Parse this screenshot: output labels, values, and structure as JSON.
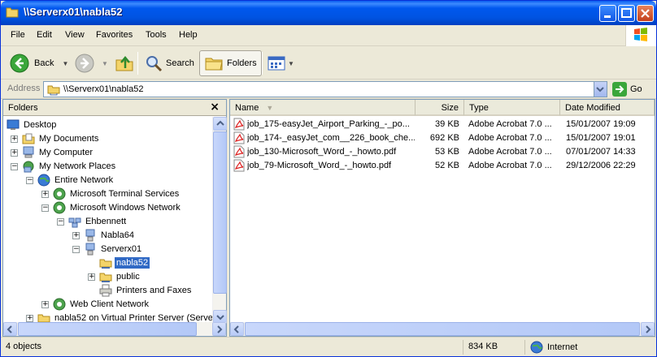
{
  "window": {
    "title": "\\\\Serverx01\\nabla52"
  },
  "menu": [
    "File",
    "Edit",
    "View",
    "Favorites",
    "Tools",
    "Help"
  ],
  "toolbar": {
    "back_label": "Back",
    "search_label": "Search",
    "folders_label": "Folders"
  },
  "address": {
    "label": "Address",
    "value": "\\\\Serverx01\\nabla52",
    "go_label": "Go"
  },
  "folders_pane": {
    "title": "Folders",
    "close_glyph": "×",
    "tree": [
      {
        "label": "Desktop"
      },
      {
        "label": "My Documents"
      },
      {
        "label": "My Computer"
      },
      {
        "label": "My Network Places"
      },
      {
        "label": "Entire Network"
      },
      {
        "label": "Microsoft Terminal Services"
      },
      {
        "label": "Microsoft Windows Network"
      },
      {
        "label": "Ehbennett"
      },
      {
        "label": "Nabla64"
      },
      {
        "label": "Serverx01"
      },
      {
        "label": "nabla52"
      },
      {
        "label": "public"
      },
      {
        "label": "Printers and Faxes"
      },
      {
        "label": "Web Client Network"
      },
      {
        "label": "nabla52 on Virtual Printer Server (Server"
      }
    ]
  },
  "file_list": {
    "columns": [
      "Name",
      "Size",
      "Type",
      "Date Modified"
    ],
    "rows": [
      {
        "name": "job_175-easyJet_Airport_Parking_-_po...",
        "size": "39 KB",
        "type": "Adobe Acrobat 7.0 ...",
        "date": "15/01/2007 19:09"
      },
      {
        "name": "job_174-_easyJet_com__226_book_che...",
        "size": "692 KB",
        "type": "Adobe Acrobat 7.0 ...",
        "date": "15/01/2007 19:01"
      },
      {
        "name": "job_130-Microsoft_Word_-_howto.pdf",
        "size": "53 KB",
        "type": "Adobe Acrobat 7.0 ...",
        "date": "07/01/2007 14:33"
      },
      {
        "name": "job_79-Microsoft_Word_-_howto.pdf",
        "size": "52 KB",
        "type": "Adobe Acrobat 7.0 ...",
        "date": "29/12/2006 22:29"
      }
    ]
  },
  "status": {
    "objects": "4 objects",
    "size": "834 KB",
    "zone": "Internet"
  }
}
